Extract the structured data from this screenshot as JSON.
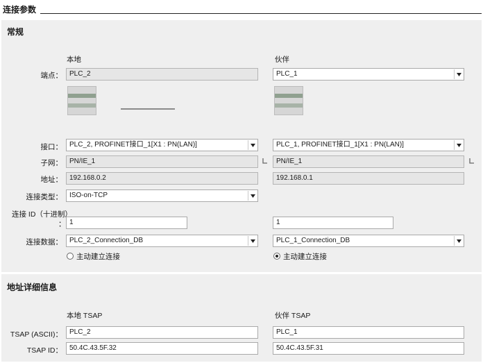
{
  "header": {
    "title": "连接参数"
  },
  "general": {
    "title": "常规",
    "local_head": "本地",
    "partner_head": "伙伴",
    "labels": {
      "endpoint": "端点：",
      "interface": "接口：",
      "subnet": "子网：",
      "address": "地址：",
      "conn_type": "连接类型：",
      "conn_id_1": "连接 ID（十进制）",
      "conn_id_2": "：",
      "conn_data": "连接数据："
    },
    "local": {
      "endpoint": "PLC_2",
      "interface": "PLC_2, PROFINET接口_1[X1 : PN(LAN)]",
      "subnet": "PN/IE_1",
      "address": "192.168.0.2",
      "conn_type": "ISO-on-TCP",
      "conn_id": "1",
      "conn_data": "PLC_2_Connection_DB",
      "active_label": "主动建立连接",
      "active": false
    },
    "partner": {
      "endpoint": "PLC_1",
      "interface": "PLC_1, PROFINET接口_1[X1 : PN(LAN)]",
      "subnet": "PN/IE_1",
      "address": "192.168.0.1",
      "conn_id": "1",
      "conn_data": "PLC_1_Connection_DB",
      "active_label": "主动建立连接",
      "active": true
    }
  },
  "address_details": {
    "title": "地址详细信息",
    "local_head": "本地 TSAP",
    "partner_head": "伙伴 TSAP",
    "labels": {
      "tsap_ascii": "TSAP (ASCII)：",
      "tsap_id": "TSAP ID："
    },
    "local": {
      "tsap_ascii": "PLC_2",
      "tsap_id": "50.4C.43.5F.32"
    },
    "partner": {
      "tsap_ascii": "PLC_1",
      "tsap_id": "50.4C.43.5F.31"
    }
  },
  "icons": {
    "dropdown": "chevron-down-icon",
    "device": "plc-device-icon",
    "subnet_pin": "network-pin-icon"
  },
  "colors": {
    "section_bg": "#efefef",
    "readonly_bg": "#e6e6e6",
    "field_border": "#a9a9a9"
  }
}
